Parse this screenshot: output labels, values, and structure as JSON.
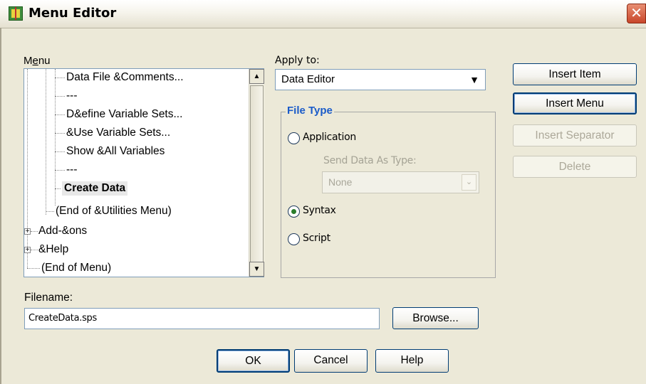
{
  "window": {
    "title": "Menu Editor",
    "close_glyph": "✕"
  },
  "menu_panel": {
    "label": "Menu",
    "label_mnemonic": "e",
    "items": [
      {
        "text": "Data File &Comments..."
      },
      {
        "text": "---"
      },
      {
        "text": "D&efine Variable Sets..."
      },
      {
        "text": "&Use Variable Sets..."
      },
      {
        "text": "Show &All Variables"
      },
      {
        "text": "---"
      },
      {
        "text": "Create Data",
        "selected": true
      },
      {
        "text": "(End of &Utilities Menu)"
      },
      {
        "text": "Add-&ons",
        "expandable": true
      },
      {
        "text": "&Help",
        "expandable": true
      },
      {
        "text": "(End of Menu)"
      }
    ],
    "expander_glyph": "+",
    "scroll_up_glyph": "▲",
    "scroll_down_glyph": "▼"
  },
  "apply_to": {
    "label": "Apply to:",
    "value": "Data Editor",
    "arrow_glyph": "▼"
  },
  "file_type": {
    "title": "File Type",
    "options": [
      {
        "label": "Application",
        "selected": false
      },
      {
        "label": "Syntax",
        "selected": true
      },
      {
        "label": "Script",
        "selected": false
      }
    ],
    "send_data_label": "Send Data As Type:",
    "send_data_value": "None",
    "send_data_arrow": "⌄"
  },
  "buttons": {
    "insert_item": "Insert Item",
    "insert_menu": "Insert Menu",
    "insert_separator": "Insert Separator",
    "delete": "Delete",
    "browse": "Browse...",
    "ok": "OK",
    "cancel": "Cancel",
    "help": "Help"
  },
  "filename": {
    "label": "Filename:",
    "value": "CreateData.sps"
  },
  "icons": {
    "app": "menu-editor-icon",
    "close": "close-icon",
    "expander": "plus-box-icon"
  }
}
